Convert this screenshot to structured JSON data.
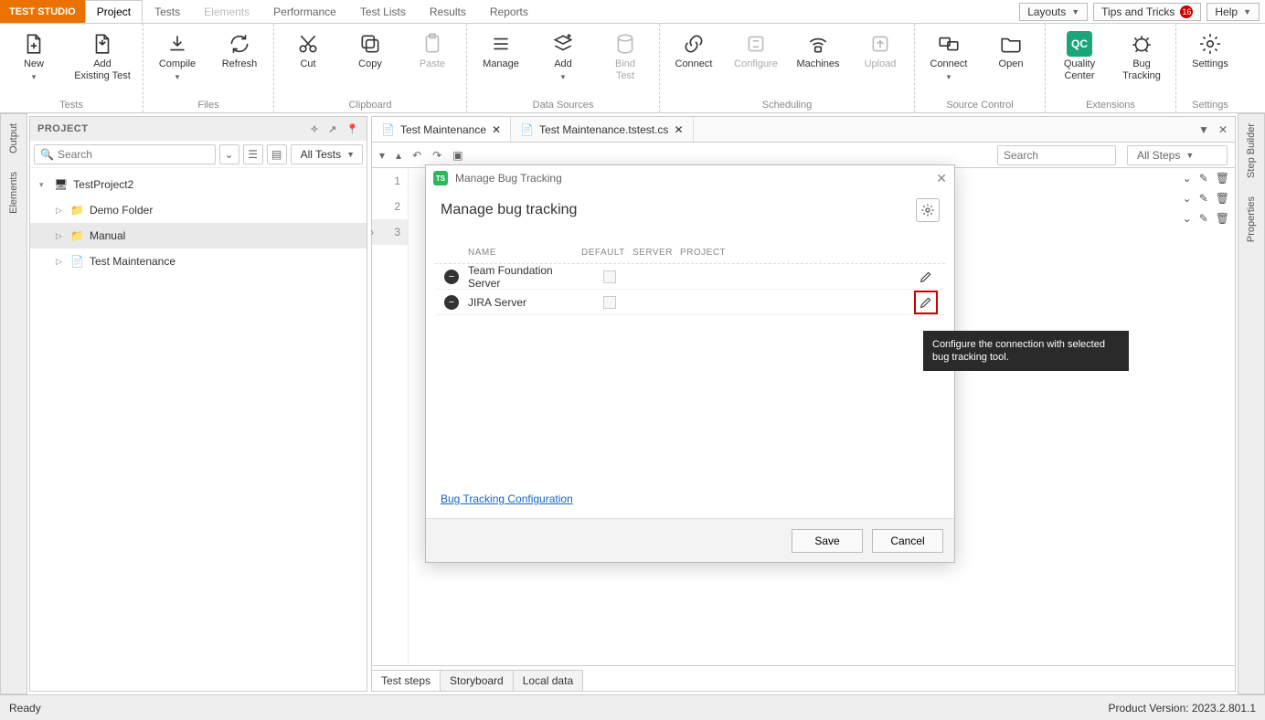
{
  "brand": "TEST STUDIO",
  "menu": {
    "project": "Project",
    "tests": "Tests",
    "elements": "Elements",
    "performance": "Performance",
    "testlists": "Test Lists",
    "results": "Results",
    "reports": "Reports"
  },
  "top_right": {
    "layouts": "Layouts",
    "tips": "Tips and Tricks",
    "tips_badge": "16",
    "help": "Help"
  },
  "ribbon": {
    "tests": {
      "label": "Tests",
      "new": "New",
      "add_existing": "Add\nExisting Test"
    },
    "files": {
      "label": "Files",
      "compile": "Compile",
      "refresh": "Refresh"
    },
    "clipboard": {
      "label": "Clipboard",
      "cut": "Cut",
      "copy": "Copy",
      "paste": "Paste"
    },
    "datasources": {
      "label": "Data Sources",
      "manage": "Manage",
      "add": "Add",
      "bind": "Bind\nTest"
    },
    "scheduling": {
      "label": "Scheduling",
      "connect": "Connect",
      "configure": "Configure",
      "machines": "Machines",
      "upload": "Upload"
    },
    "sourcecontrol": {
      "label": "Source Control",
      "connect": "Connect",
      "open": "Open"
    },
    "extensions": {
      "label": "Extensions",
      "qc": "Quality\nCenter",
      "bug": "Bug\nTracking"
    },
    "settings": {
      "label": "Settings",
      "settings": "Settings"
    }
  },
  "side_left": {
    "output": "Output",
    "elements": "Elements"
  },
  "side_right": {
    "stepbuilder": "Step Builder",
    "properties": "Properties"
  },
  "project_panel": {
    "title": "PROJECT",
    "search_placeholder": "Search",
    "filter": "All Tests",
    "tree": {
      "root": "TestProject2",
      "demo": "Demo Folder",
      "manual": "Manual",
      "maint": "Test Maintenance"
    }
  },
  "file_tabs": {
    "t1": "Test Maintenance",
    "t2": "Test Maintenance.tstest.cs"
  },
  "steps": {
    "search_placeholder": "Search",
    "filter": "All Steps",
    "lines": [
      "1",
      "2",
      "3"
    ]
  },
  "bottom_tabs": {
    "steps": "Test steps",
    "storyboard": "Storyboard",
    "localdata": "Local data"
  },
  "dialog": {
    "window_title": "Manage Bug Tracking",
    "heading": "Manage bug tracking",
    "cols": {
      "name": "NAME",
      "default": "DEFAULT",
      "server": "SERVER",
      "project": "PROJECT"
    },
    "rows": {
      "tfs": "Team Foundation Server",
      "jira": "JIRA Server"
    },
    "link": "Bug Tracking Configuration",
    "save": "Save",
    "cancel": "Cancel"
  },
  "tooltip": "Configure the connection with selected bug tracking tool.",
  "status": {
    "ready": "Ready",
    "version": "Product Version: 2023.2.801.1"
  }
}
